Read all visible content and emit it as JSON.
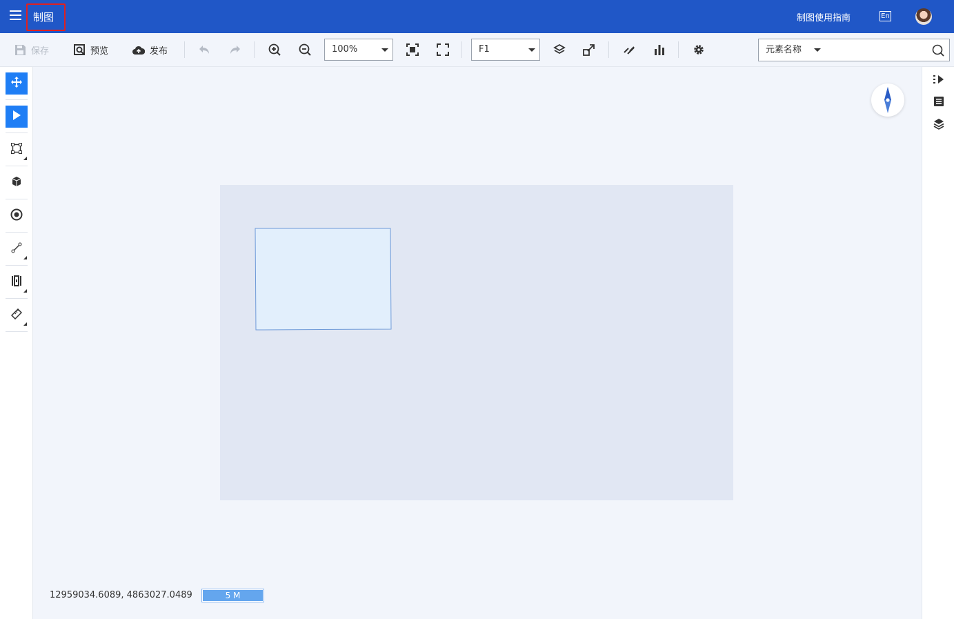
{
  "header": {
    "app_title": "制图",
    "guide_link": "制图使用指南",
    "lang_label": "En",
    "colors": {
      "bar": "#2057c7",
      "highlight_border": "#e0201f"
    }
  },
  "toolbar": {
    "save_label": "保存",
    "preview_label": "预览",
    "publish_label": "发布",
    "zoom_value": "100%",
    "floor_value": "F1",
    "search_category": "元素名称",
    "search_value": ""
  },
  "left_tools": [
    {
      "name": "pan",
      "icon": "move-arrows-icon",
      "active": true
    },
    {
      "name": "select",
      "icon": "cursor-arrow-icon",
      "active": true
    },
    {
      "name": "rectangle",
      "icon": "square-nodes-icon",
      "active": false,
      "submenu": true
    },
    {
      "name": "block",
      "icon": "cube-icon",
      "active": false
    },
    {
      "name": "circle",
      "icon": "target-circle-icon",
      "active": false
    },
    {
      "name": "line",
      "icon": "line-segment-icon",
      "active": false,
      "submenu": true
    },
    {
      "name": "door",
      "icon": "door-panel-icon",
      "active": false,
      "submenu": true
    },
    {
      "name": "measure",
      "icon": "ruler-icon",
      "active": false,
      "submenu": true
    }
  ],
  "right_tools": [
    "expand-panel-icon",
    "list-panel-icon",
    "layers-panel-icon"
  ],
  "map": {
    "coordinates": "12959034.6089, 4863027.0489",
    "scale_label": "5 M",
    "accent": "#1f7ef5"
  }
}
